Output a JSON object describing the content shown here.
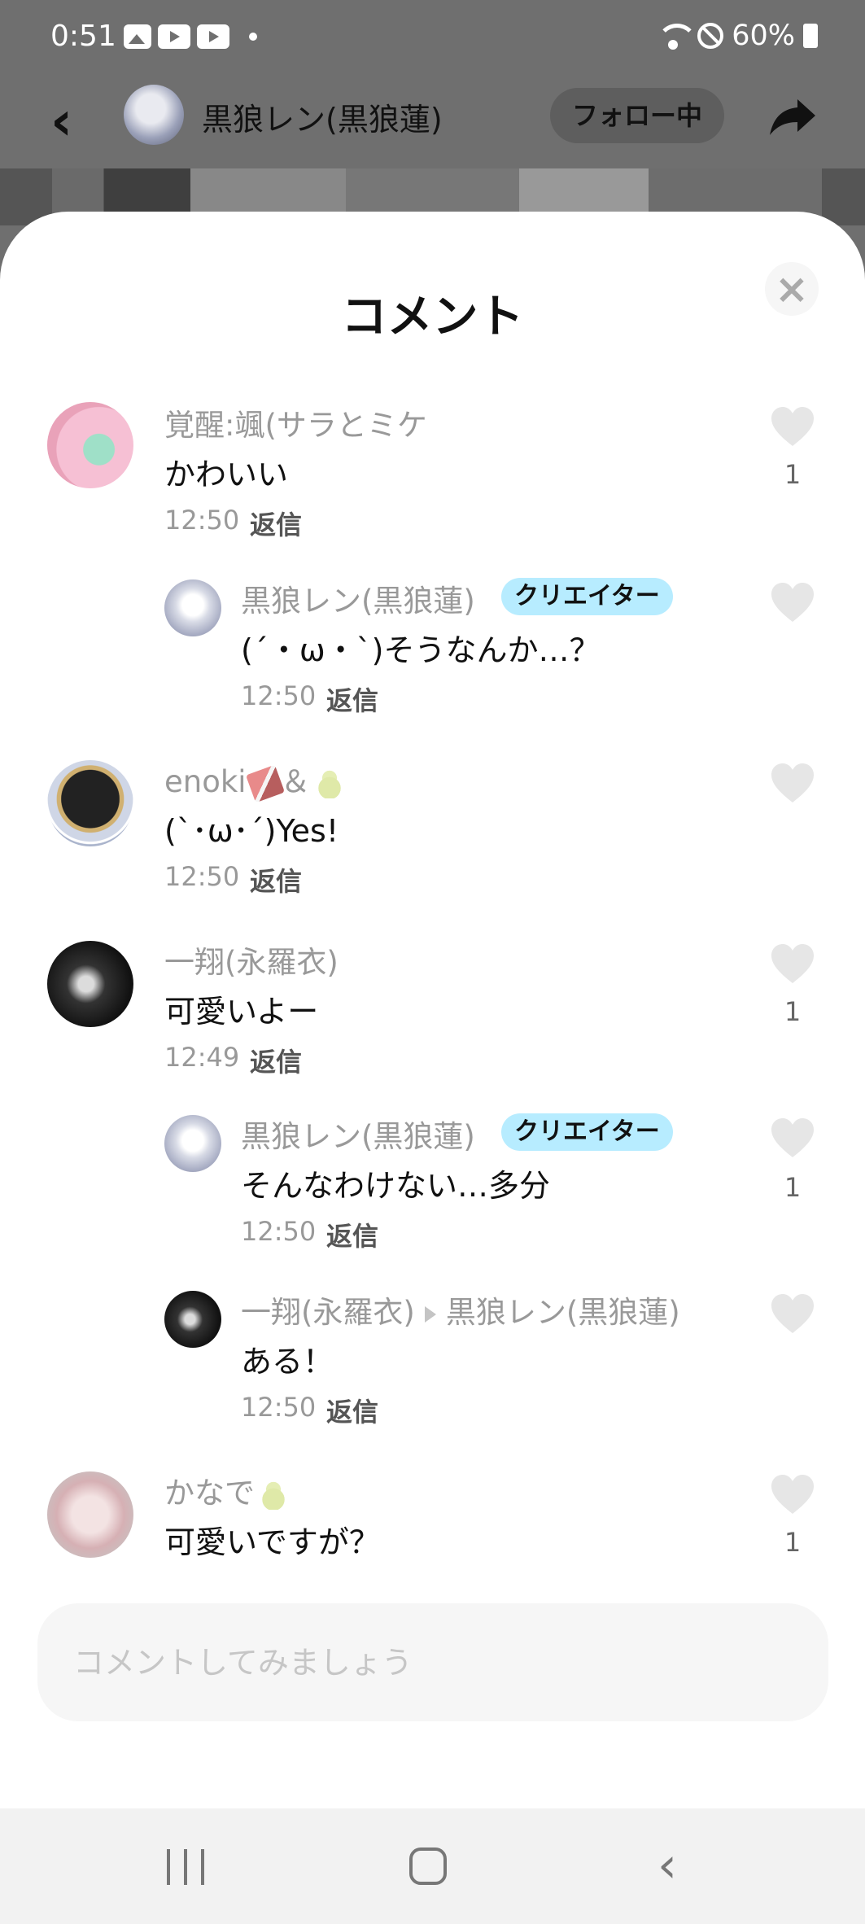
{
  "status_bar": {
    "time": "0:51",
    "battery": "60%"
  },
  "header": {
    "back_icon": "‹",
    "title": "黒狼レン(黒狼蓮)",
    "follow_label": "フォロー中"
  },
  "sheet": {
    "title": "コメント",
    "close_icon": "×"
  },
  "comments": [
    {
      "name": "覚醒:颯(サラとミケ",
      "text": "かわいい",
      "time": "12:50",
      "reply": "返信",
      "likes": "1"
    },
    {
      "name": "黒狼レン(黒狼蓮)",
      "badge": "クリエイター",
      "text": "(´・ω・`)そうなんか…？",
      "time": "12:50",
      "reply": "返信",
      "likes": ""
    },
    {
      "name": "enoki",
      "name_suffix": "＆",
      "text": "(`･ω･´)Yes!",
      "time": "12:50",
      "reply": "返信",
      "likes": ""
    },
    {
      "name": "一翔(永羅衣)",
      "text": "可愛いよー",
      "time": "12:49",
      "reply": "返信",
      "likes": "1"
    },
    {
      "name": "黒狼レン(黒狼蓮)",
      "badge": "クリエイター",
      "text": "そんなわけない…多分",
      "time": "12:50",
      "reply": "返信",
      "likes": "1"
    },
    {
      "name": "一翔(永羅衣)",
      "reply_to": "黒狼レン(黒狼蓮)",
      "text": "ある！",
      "time": "12:50",
      "reply": "返信",
      "likes": ""
    },
    {
      "name": "かなで",
      "text": "可愛いですが？",
      "likes": "1"
    }
  ],
  "input": {
    "placeholder": "コメントしてみましょう"
  },
  "icons": {
    "heart": "heart-icon",
    "share": "share-icon",
    "close": "close-icon"
  },
  "colors": {
    "badge_bg": "#b7ecff",
    "heart": "#e6e6e6",
    "dim_overlay": "#6f6f6f"
  }
}
